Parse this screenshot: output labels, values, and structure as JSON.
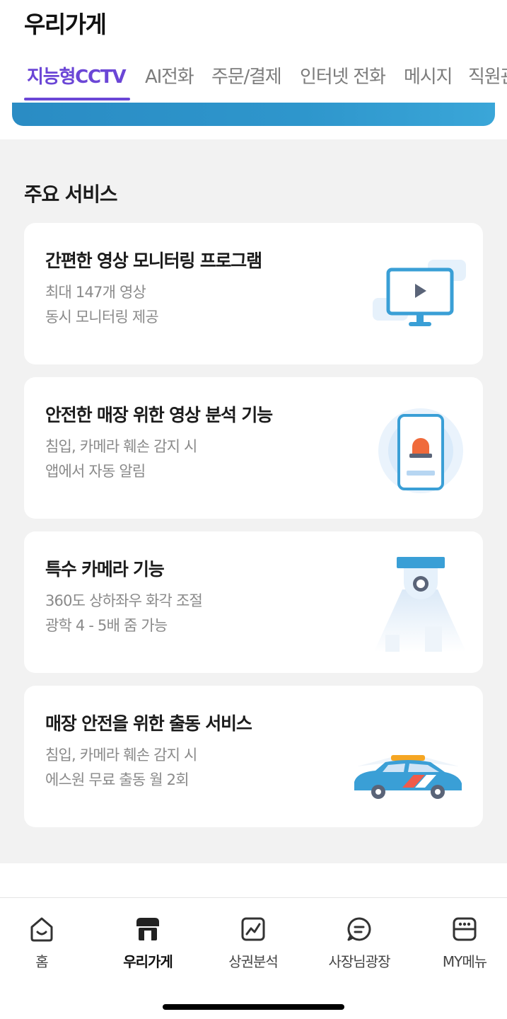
{
  "header": {
    "title": "우리가게",
    "tabs": [
      {
        "label": "지능형CCTV",
        "active": true
      },
      {
        "label": "AI전화",
        "active": false
      },
      {
        "label": "주문/결제",
        "active": false
      },
      {
        "label": "인터넷 전화",
        "active": false
      },
      {
        "label": "메시지",
        "active": false
      },
      {
        "label": "직원관리",
        "active": false
      }
    ]
  },
  "main": {
    "section_title": "주요 서비스",
    "cards": [
      {
        "title": "간편한 영상 모니터링 프로그램",
        "desc_line1": "최대 147개 영상",
        "desc_line2": "동시 모니터링 제공",
        "icon": "monitor-play-icon"
      },
      {
        "title": "안전한 매장 위한 영상 분석 기능",
        "desc_line1": "침입, 카메라 훼손 감지 시",
        "desc_line2": "앱에서 자동 알림",
        "icon": "phone-siren-icon"
      },
      {
        "title": "특수 카메라 기능",
        "desc_line1": "360도 상하좌우 화각 조절",
        "desc_line2": "광학 4 - 5배 줌 가능",
        "icon": "dome-camera-icon"
      },
      {
        "title": "매장 안전을 위한 출동 서비스",
        "desc_line1": "침입, 카메라 훼손 감지 시",
        "desc_line2": "에스원 무료 출동 월 2회",
        "icon": "patrol-car-icon"
      }
    ]
  },
  "bottom_nav": {
    "items": [
      {
        "label": "홈",
        "icon": "home-icon",
        "active": false
      },
      {
        "label": "우리가게",
        "icon": "store-icon",
        "active": true
      },
      {
        "label": "상권분석",
        "icon": "chart-icon",
        "active": false
      },
      {
        "label": "사장님광장",
        "icon": "chat-icon",
        "active": false
      },
      {
        "label": "MY메뉴",
        "icon": "my-menu-icon",
        "active": false
      }
    ]
  },
  "colors": {
    "accent": "#6b46d6",
    "banner": "#2e96cc",
    "illustration_blue": "#3a9fd6",
    "background": "#f2f2f2"
  }
}
